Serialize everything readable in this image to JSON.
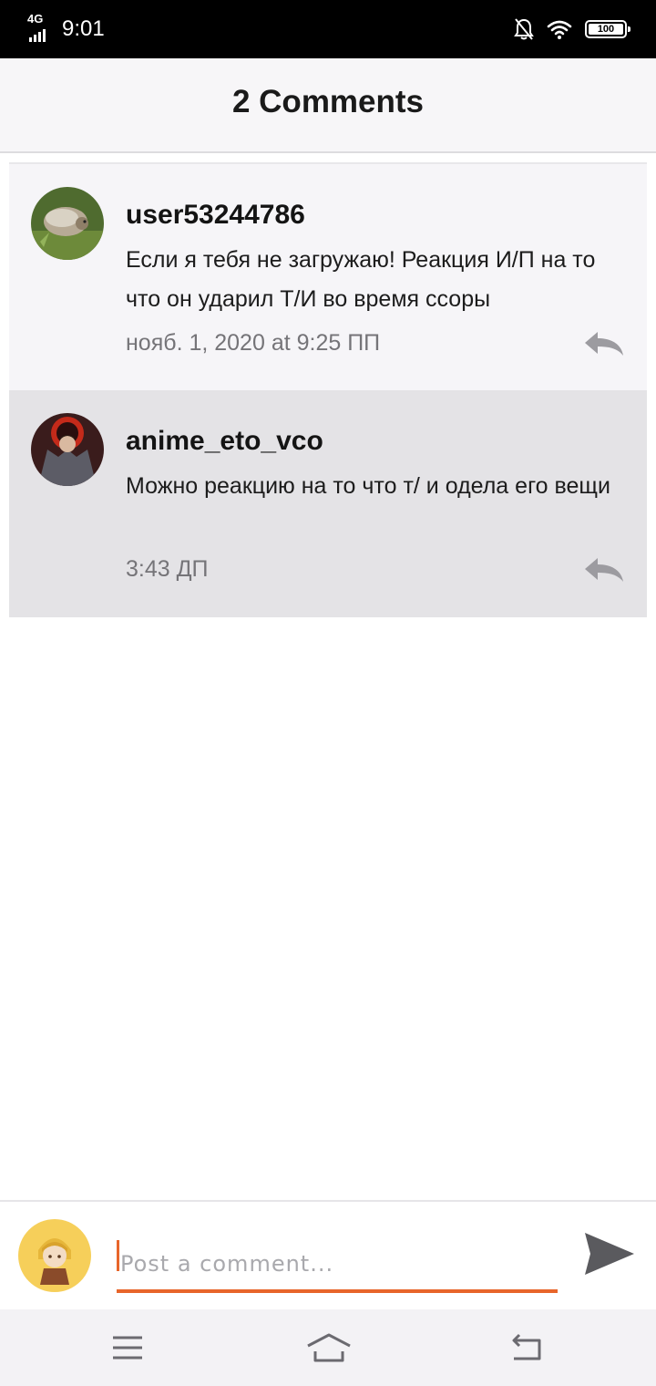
{
  "status_bar": {
    "network": "4G",
    "time": "9:01",
    "battery_level": "100",
    "icons": [
      "signal-icon",
      "notifications-off-icon",
      "wifi-icon",
      "battery-icon"
    ]
  },
  "header": {
    "title": "2 Comments"
  },
  "comments": [
    {
      "username": "user53244786",
      "text": "Если я тебя не загружаю! Реакция И/П на то что он ударил Т/И во время ссоры",
      "time": "нояб. 1, 2020 at 9:25 ПП",
      "icon": "reply-icon"
    },
    {
      "username": "anime_eto_vco",
      "text": "Можно реакцию на то что т/ и одела его вещи",
      "time": "3:43 ДП",
      "icon": "reply-icon"
    }
  ],
  "composer": {
    "placeholder": "Post a comment...",
    "value": "",
    "send_icon": "send-icon"
  },
  "nav_bar": {
    "icons": [
      "menu-icon",
      "home-icon",
      "back-icon"
    ]
  },
  "colors": {
    "accent": "#e8652a",
    "header_bg": "#f7f6f8",
    "comment_bg": "#f6f5f8",
    "comment_selected_bg": "#e4e3e6",
    "muted_text": "#757478"
  }
}
